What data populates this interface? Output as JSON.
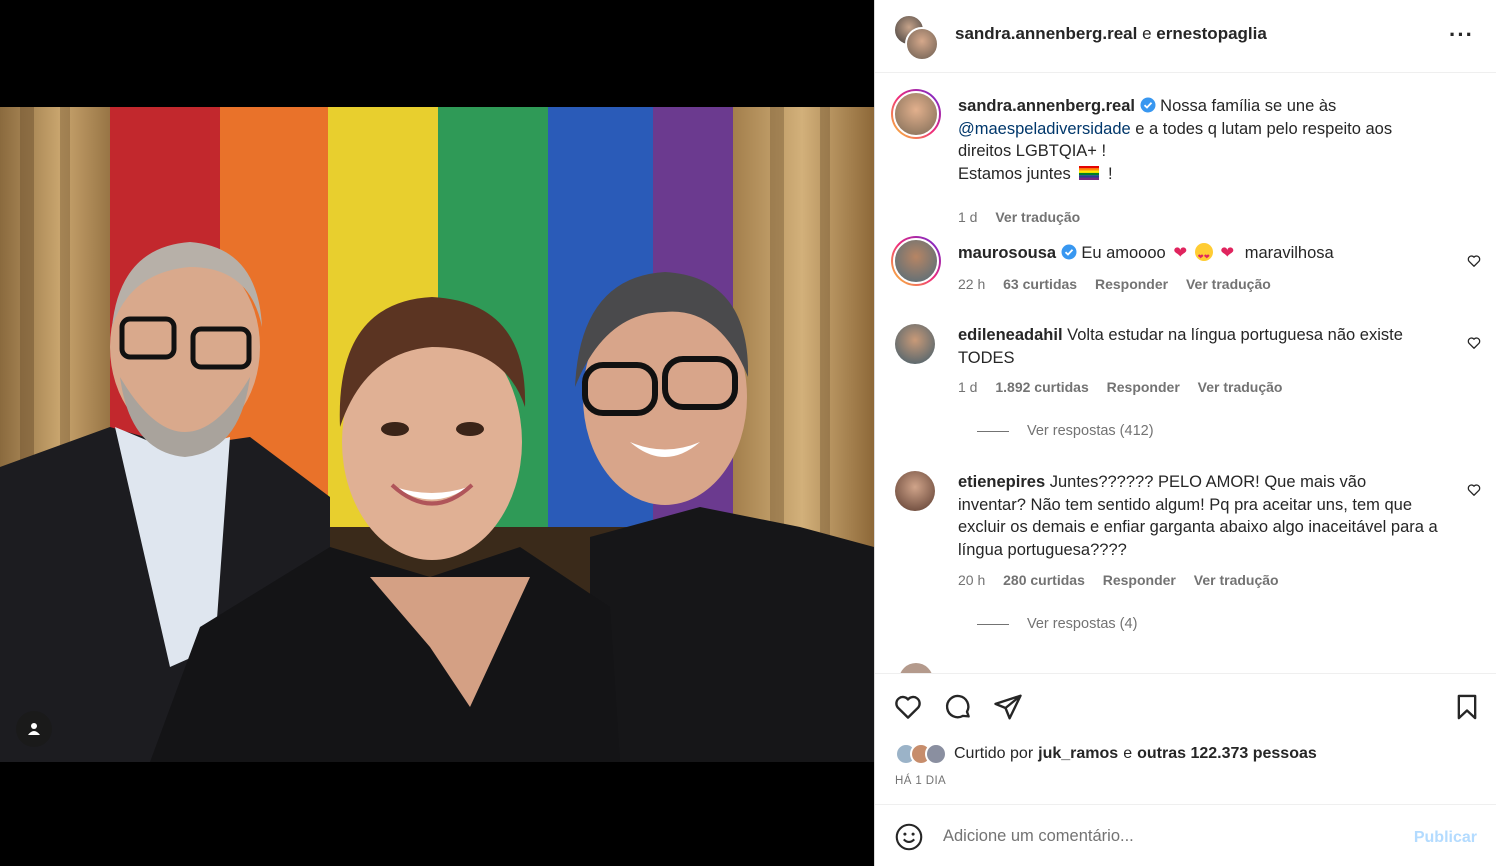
{
  "header": {
    "user1": "sandra.annenberg.real",
    "joiner": "e",
    "user2": "ernestopaglia",
    "more_icon": "more-horizontal-icon"
  },
  "caption": {
    "username": "sandra.annenberg.real",
    "text_1": "Nossa família se une às",
    "mention": "@maespeladiversidade",
    "text_2": "e a todes q lutam pelo respeito aos direitos LGBTQIA+ !",
    "text_3": "Estamos juntes",
    "text_3_end": "!",
    "time": "1 d",
    "translate": "Ver tradução"
  },
  "comments": [
    {
      "username": "maurosousa",
      "verified": true,
      "text": "Eu amoooo",
      "text_end": "maravilhosa",
      "time": "22 h",
      "likes": "63 curtidas",
      "reply": "Responder",
      "translate": "Ver tradução"
    },
    {
      "username": "edileneadahil",
      "text": "Volta estudar na língua portuguesa não existe TODES",
      "time": "1 d",
      "likes": "1.892 curtidas",
      "reply": "Responder",
      "translate": "Ver tradução",
      "view_replies": "Ver respostas (412)"
    },
    {
      "username": "etienepires",
      "text": "Juntes?????? PELO AMOR! Que mais vão inventar? Não tem sentido algum! Pq pra aceitar uns, tem que excluir os demais e enfiar garganta abaixo algo inaceitável para a língua portuguesa????",
      "time": "20 h",
      "likes": "280 curtidas",
      "reply": "Responder",
      "translate": "Ver tradução",
      "view_replies": "Ver respostas (4)"
    }
  ],
  "likes": {
    "prefix": "Curtido por",
    "user": "juk_ramos",
    "joiner": "e",
    "others": "outras 122.373 pessoas",
    "date": "HÁ 1 DIA"
  },
  "add_comment": {
    "placeholder": "Adicione um comentário...",
    "publish": "Publicar"
  },
  "colors": {
    "verified": "#3897f0",
    "link": "#00376b",
    "publish_disabled": "#b3dbff"
  }
}
